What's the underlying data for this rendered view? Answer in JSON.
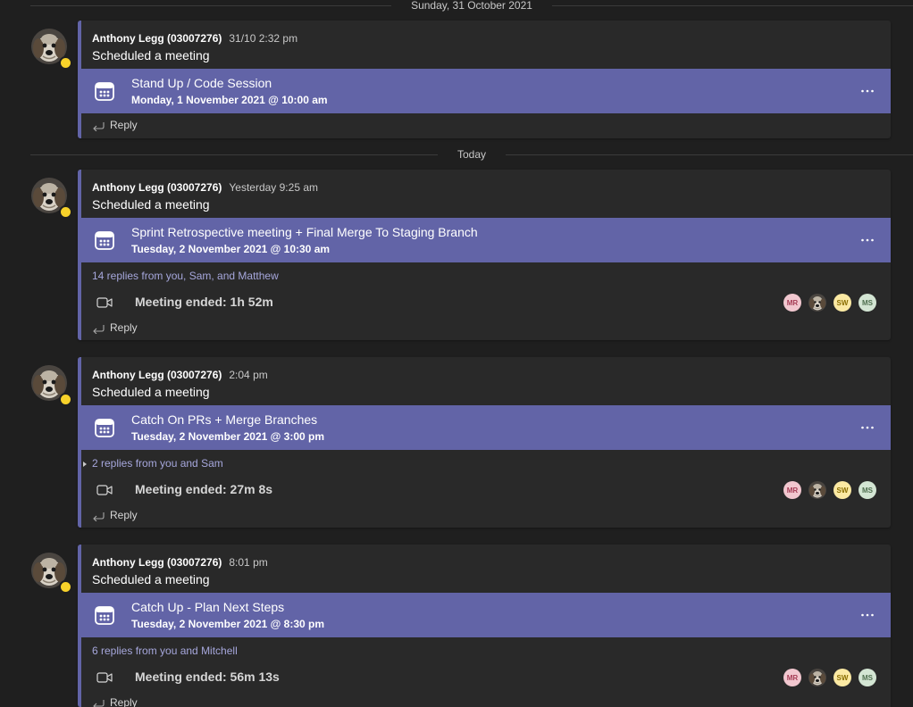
{
  "dividers": {
    "first": "Sunday, 31 October 2021",
    "second": "Today"
  },
  "colors": {
    "background": "#1f1f1f",
    "card": "#292929",
    "accent": "#6264a7",
    "link": "#a6a7dc",
    "presence_away": "#f8d22a"
  },
  "reply_label": "Reply",
  "participants": [
    {
      "initials": "MR",
      "bg": "#f1c7cf",
      "fg": "#a53c55"
    },
    {
      "initials": "",
      "icon": "dog-avatar"
    },
    {
      "initials": "SW",
      "bg": "#fbe9a3",
      "fg": "#8a6d00"
    },
    {
      "initials": "MS",
      "bg": "#d3e5d3",
      "fg": "#4f6f4f"
    }
  ],
  "threads": [
    {
      "author": "Anthony Legg (03007276)",
      "time": "31/10 2:32 pm",
      "text": "Scheduled a meeting",
      "meeting_title": "Stand Up / Code Session",
      "meeting_date": "Monday, 1 November 2021 @ 10:00 am"
    },
    {
      "author": "Anthony Legg (03007276)",
      "time": "Yesterday 9:25 am",
      "text": "Scheduled a meeting",
      "meeting_title": "Sprint Retrospective meeting + Final Merge To Staging Branch",
      "meeting_date": "Tuesday, 2 November 2021 @ 10:30 am",
      "replies": "14 replies from you, Sam, and Matthew",
      "ended": "Meeting ended: 1h 52m"
    },
    {
      "author": "Anthony Legg (03007276)",
      "time": "2:04 pm",
      "text": "Scheduled a meeting",
      "meeting_title": "Catch On PRs + Merge Branches",
      "meeting_date": "Tuesday, 2 November 2021 @ 3:00 pm",
      "replies": "2 replies from you and Sam",
      "ended": "Meeting ended: 27m 8s"
    },
    {
      "author": "Anthony Legg (03007276)",
      "time": "8:01 pm",
      "text": "Scheduled a meeting",
      "meeting_title": "Catch Up - Plan Next Steps",
      "meeting_date": "Tuesday, 2 November 2021 @ 8:30 pm",
      "replies": "6 replies from you and Mitchell",
      "ended": "Meeting ended: 56m 13s"
    }
  ]
}
